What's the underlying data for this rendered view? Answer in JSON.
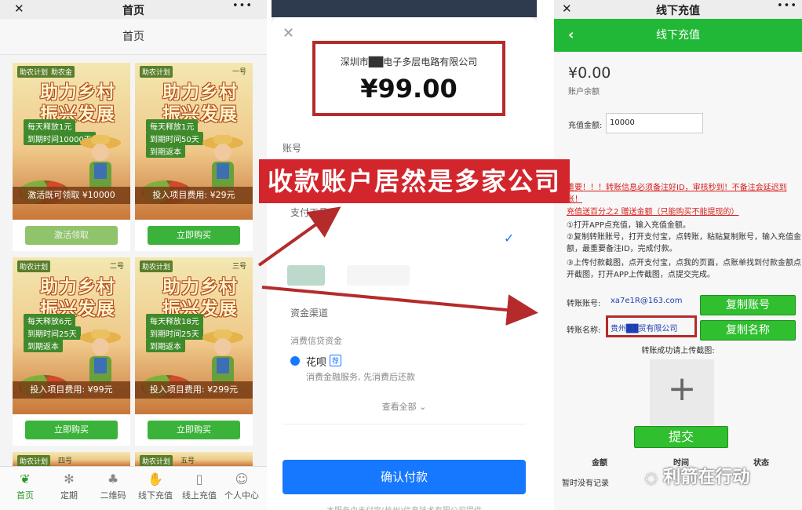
{
  "panel1": {
    "topbar": {
      "close": "✕",
      "title": "首页",
      "more": "•••"
    },
    "subtitle": "首页",
    "cards": [
      {
        "tag": "助农计划",
        "tag2": "助农金",
        "headline1": "助力乡村",
        "headline2": "振兴发展",
        "lines": [
          "每天释放1元",
          "到期时间10000天"
        ],
        "price": "激活既可领取 ¥10000",
        "button": "激活领取",
        "active": true
      },
      {
        "tag": "助农计划",
        "tag2": "一号",
        "headline1": "助力乡村",
        "headline2": "振兴发展",
        "lines": [
          "每天释放1元",
          "到期时间50天",
          "到期返本"
        ],
        "price": "投入项目费用: ¥29元",
        "button": "立即购买",
        "active": false
      },
      {
        "tag": "助农计划",
        "tag2": "二号",
        "headline1": "助力乡村",
        "headline2": "振兴发展",
        "lines": [
          "每天释放6元",
          "到期时间25天",
          "到期返本"
        ],
        "price": "投入项目费用: ¥99元",
        "button": "立即购买",
        "active": false
      },
      {
        "tag": "助农计划",
        "tag2": "三号",
        "headline1": "助力乡村",
        "headline2": "振兴发展",
        "lines": [
          "每天释放18元",
          "到期时间25天",
          "到期返本"
        ],
        "price": "投入项目费用: ¥299元",
        "button": "立即购买",
        "active": false
      }
    ],
    "partial_cards": [
      {
        "tag": "助农计划",
        "tag2": "四号"
      },
      {
        "tag": "助农计划",
        "tag2": "五号"
      }
    ],
    "tabs": [
      "首页",
      "定期",
      "二维码",
      "线下充值",
      "线上充值",
      "个人中心"
    ]
  },
  "panel2": {
    "close": "✕",
    "payee": "深圳市██电子多层电路有限公司",
    "amount": "¥99.00",
    "account_label": "账号",
    "pay_tool_label": "支付工具",
    "channel_label": "资金渠道",
    "credit_label": "消费信贷资金",
    "huabei_name": "花呗",
    "huabei_badge": "荐",
    "huabei_desc": "消费金融服务, 先消费后还款",
    "view_all": "查看全部",
    "confirm": "确认付款",
    "footer": "本服务由支付宝(杭州)信息技术有限公司提供"
  },
  "panel3": {
    "topbar": {
      "close": "✕",
      "title": "线下充值",
      "more": "•••"
    },
    "header": "线下充值",
    "balance": "¥0.00",
    "balance_label": "账户余额",
    "recharge_label": "充值金额:",
    "recharge_value": "10000",
    "warning1": "重要！！！转账信息必须备注好ID，审核秒到！不备注会延迟到账！",
    "warning2": "充值送百分之2 赠送金额（只能购买不能提现的）",
    "step1": "①打开APP点充值，输入充值金额。",
    "step2": "②复制转账账号，打开支付宝，点转账，粘贴复制账号，输入充值金额，最重要备注ID，完成付款。",
    "step3": "③上传付款截图，点开支付宝，点我的页面，点账单找到付款金额点开截图，打开APP上传截图，点提交完成。",
    "account_label": "转账账号:",
    "account_value": "xa7e1R@163.com",
    "copy_account": "复制账号",
    "name_label": "转账名称:",
    "name_value": "贵州██贸有限公司",
    "copy_name": "复制名称",
    "upload_label": "转账成功请上传截图:",
    "submit": "提交",
    "columns": [
      "金额",
      "时间",
      "状态"
    ],
    "empty": "暂时没有记录"
  },
  "banner": "收款账户居然是多家公司",
  "watermark": "利箭在行动",
  "colors": {
    "green": "#22b837",
    "red": "#d3262c",
    "blue": "#1677ff"
  }
}
